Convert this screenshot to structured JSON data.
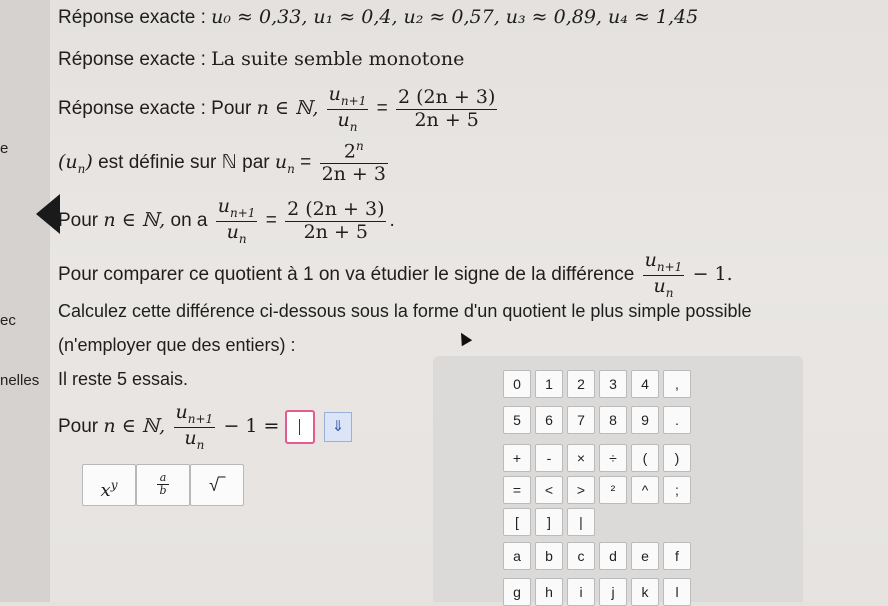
{
  "left_strip": {
    "frag1": "e",
    "frag2": "ec",
    "frag3": "nelles"
  },
  "line1": {
    "label": "Réponse exacte :",
    "values": "u₀ ≈ 0,33, u₁ ≈ 0,4, u₂ ≈ 0,57, u₃ ≈ 0,89, u₄ ≈ 1,45"
  },
  "line2": {
    "label": "Réponse exacte :",
    "text": "La suite semble monotone"
  },
  "line3": {
    "label": "Réponse exacte : Pour",
    "set": "n ∈ ℕ,",
    "num": "u",
    "num_sub": "n+1",
    "den": "u",
    "den_sub": "n",
    "eq": "=",
    "rnum": "2 (2n + 3)",
    "rden": "2n + 5"
  },
  "line4": {
    "seq": "(u",
    "seq_sub": "n",
    "seq_close": ")",
    "text": "est définie sur ℕ par",
    "un": "u",
    "un_sub": "n",
    "eq": "=",
    "num": "2",
    "num_sup": "n",
    "den": "2n + 3"
  },
  "line5": {
    "lead": "Pour",
    "set": "n ∈ ℕ,",
    "on_a": "on a",
    "num": "u",
    "num_sub": "n+1",
    "den": "u",
    "den_sub": "n",
    "eq": "=",
    "rnum": "2 (2n + 3)",
    "rden": "2n + 5",
    "end": "."
  },
  "line6": {
    "text": "Pour comparer ce quotient à 1 on va étudier le signe de la différence",
    "num": "u",
    "num_sub": "n+1",
    "den": "u",
    "den_sub": "n",
    "tail": "− 1."
  },
  "line7": {
    "text": "Calculez cette différence ci-dessous sous la forme d'un quotient le plus simple possible"
  },
  "line8": {
    "text": "(n'employer que des entiers) :"
  },
  "line9": {
    "text": "Il reste 5 essais."
  },
  "input_line": {
    "lead": "Pour",
    "set": "n ∈ ℕ,",
    "num": "u",
    "num_sub": "n+1",
    "den": "u",
    "den_sub": "n",
    "minus": "− 1 =",
    "arrow": "⇓"
  },
  "tools": {
    "power": "x",
    "power_sup": "y",
    "frac_num": "a",
    "frac_den": "b",
    "sqrt": "√‾"
  },
  "keypad": {
    "row1": [
      "0",
      "1",
      "2",
      "3",
      "4",
      ","
    ],
    "row2": [
      "5",
      "6",
      "7",
      "8",
      "9",
      "."
    ],
    "row3": [
      "+",
      "-",
      "×",
      "÷",
      "(",
      ")"
    ],
    "row4": [
      "=",
      "<",
      ">",
      "²",
      "^",
      ";"
    ],
    "row5": [
      "[",
      "]",
      "|"
    ],
    "row6": [
      "a",
      "b",
      "c",
      "d",
      "e",
      "f"
    ],
    "row7": [
      "g",
      "h",
      "i",
      "j",
      "k",
      "l"
    ]
  }
}
